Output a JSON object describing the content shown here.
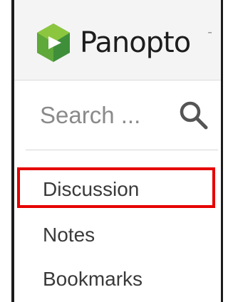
{
  "header": {
    "brand_name": "Panopto",
    "trademark": "™",
    "logo_icon": "panopto-logo-icon"
  },
  "search": {
    "placeholder": "Search ...",
    "icon": "search-icon"
  },
  "nav": {
    "items": [
      {
        "label": "Discussion",
        "highlighted": true
      },
      {
        "label": "Notes"
      },
      {
        "label": "Bookmarks"
      }
    ]
  },
  "colors": {
    "highlight": "#e60000",
    "logo_green_light": "#7cc142",
    "logo_green_dark": "#3f8f3a",
    "text": "#3a3a3a",
    "placeholder": "#8a8a8a"
  }
}
